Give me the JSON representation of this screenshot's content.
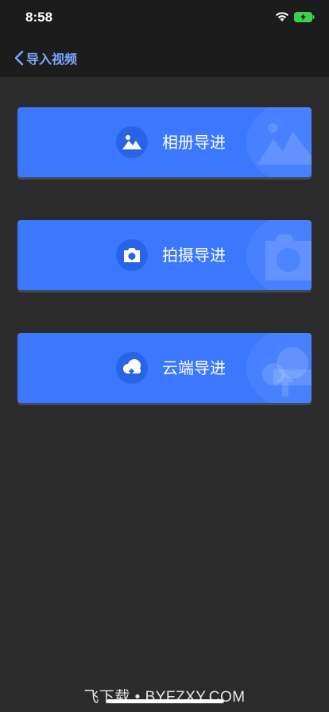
{
  "status_bar": {
    "time": "8:58"
  },
  "nav": {
    "back_label": "导入视频"
  },
  "options": [
    {
      "label": "相册导进",
      "icon": "photo-icon"
    },
    {
      "label": "拍摄导进",
      "icon": "camera-icon"
    },
    {
      "label": "云端导进",
      "icon": "cloud-upload-icon"
    }
  ],
  "watermark": "飞下载 • BYFZXY.COM",
  "colors": {
    "accent": "#3b78ff",
    "background": "#2b2b2b",
    "nav_bg": "#1c1c1c",
    "link": "#7aa8ff"
  }
}
